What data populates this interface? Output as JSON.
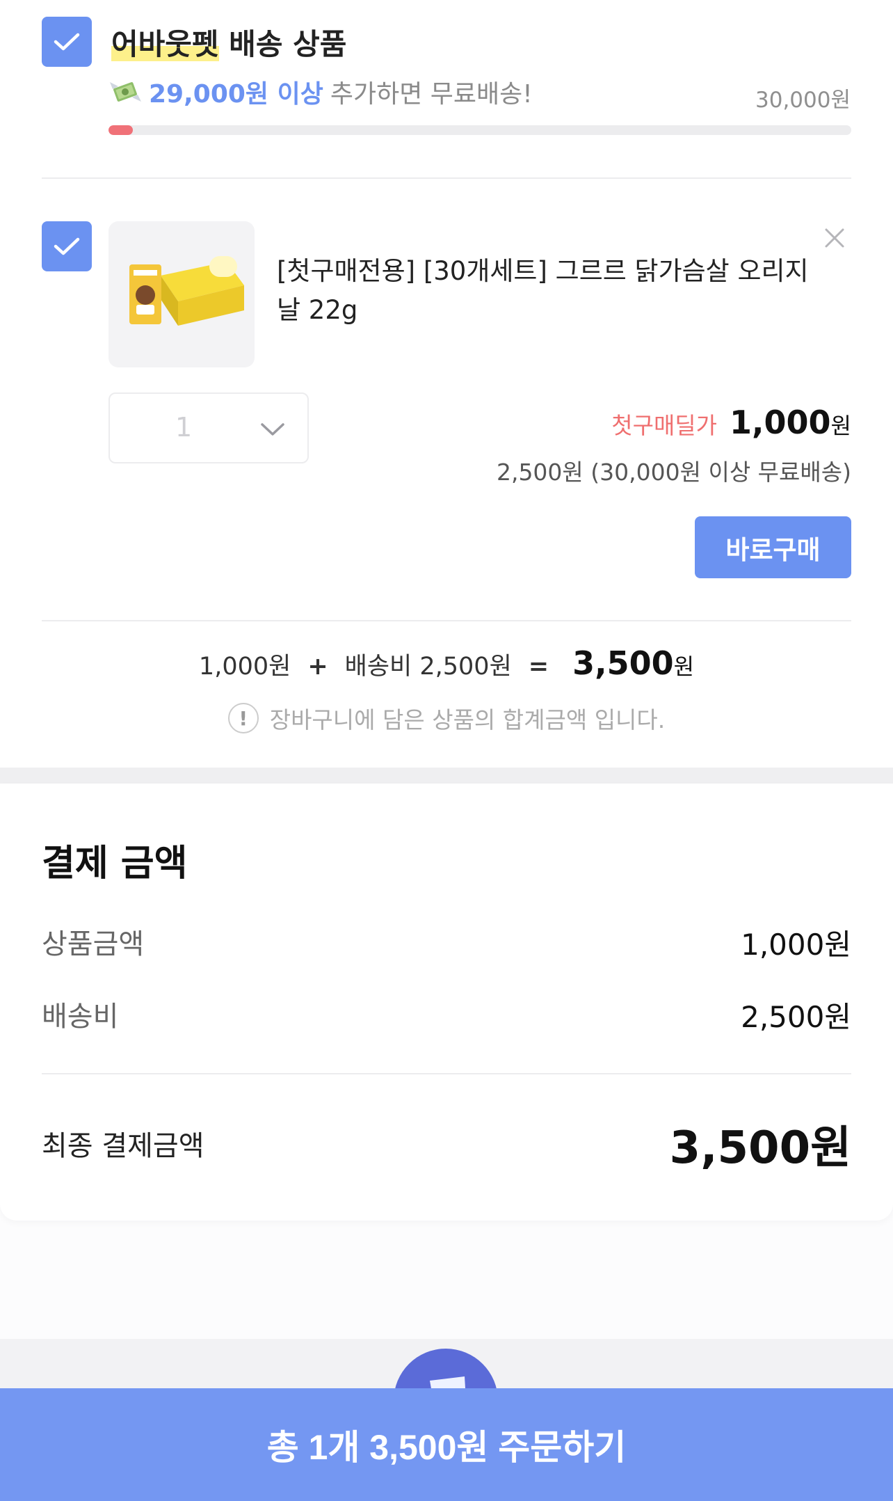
{
  "group": {
    "title_highlight": "어바웃펫",
    "title_rest": " 배송 상품",
    "free_shipping_amount": "29,000원 이상",
    "free_shipping_text": "추가하면 무료배송!",
    "threshold": "30,000원",
    "progress_fraction": 0.033,
    "icons": {
      "checkbox": "check-icon",
      "money": "money-wings-icon"
    }
  },
  "item": {
    "name": "[첫구매전용] [30개세트] 그르르 닭가슴살 오리지날 22g",
    "quantity": "1",
    "deal_label": "첫구매딜가",
    "price": "1,000",
    "price_unit": "원",
    "shipping_note": "2,500원 (30,000원 이상 무료배송)",
    "buy_now_label": "바로구매",
    "icons": {
      "remove": "close-icon",
      "dropdown": "chevron-down-icon"
    }
  },
  "summary": {
    "product_amount": "1,000원",
    "plus": "+",
    "shipping": "배송비 2,500원",
    "equals": "=",
    "total": "3,500",
    "total_unit": "원",
    "info_icon_glyph": "!",
    "note": "장바구니에 담은 상품의 합계금액 입니다."
  },
  "payment": {
    "title": "결제 금액",
    "rows": [
      {
        "label": "상품금액",
        "value": "1,000원"
      },
      {
        "label": "배송비",
        "value": "2,500원"
      }
    ],
    "final_label": "최종 결제금액",
    "final_value": "3,500원"
  },
  "order_button": {
    "label": "총 1개 3,500원 주문하기"
  },
  "colors": {
    "accent": "#6b92f1",
    "order_bar": "#7497f2",
    "deal_red": "#ef6f6f",
    "progress_red": "#f07178"
  }
}
